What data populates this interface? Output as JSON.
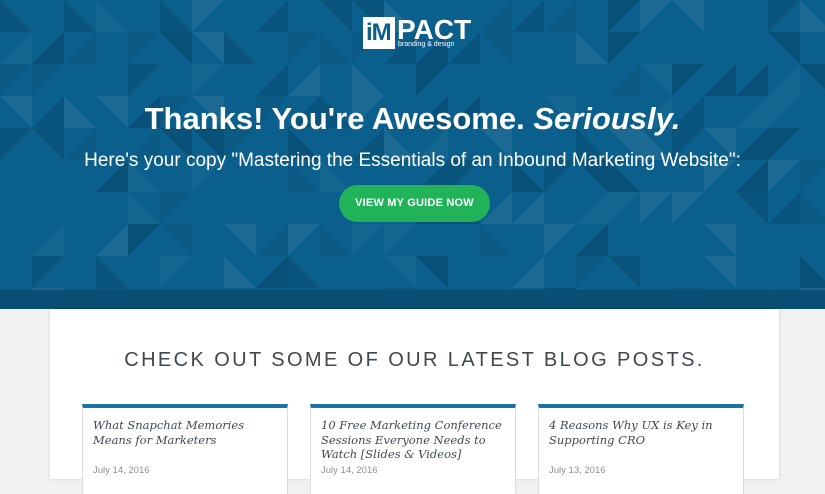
{
  "logo": {
    "mark_letter": "iM",
    "word": "PACT",
    "tagline": "branding & design"
  },
  "hero": {
    "title_main": "Thanks! You're Awesome.",
    "title_emphasis": "Seriously.",
    "subtitle": "Here's your copy \"Mastering the Essentials of an Inbound Marketing Website\":",
    "cta_label": "VIEW MY GUIDE NOW"
  },
  "blog": {
    "heading": "CHECK OUT SOME OF OUR LATEST BLOG POSTS.",
    "posts": [
      {
        "title": "What Snapchat Memories Means for Marketers",
        "date": "July 14, 2016"
      },
      {
        "title": "10 Free Marketing Conference Sessions Everyone Needs to Watch [Slides & Videos]",
        "date": "July 14, 2016"
      },
      {
        "title": "4 Reasons Why UX is Key in Supporting CRO",
        "date": "July 13, 2016"
      }
    ]
  },
  "colors": {
    "hero_background": "#0b5f8c",
    "hero_band": "#0a4e73",
    "cta_green": "#21b35a",
    "card_accent": "#1a72a8",
    "page_background": "#f1f1f1"
  }
}
